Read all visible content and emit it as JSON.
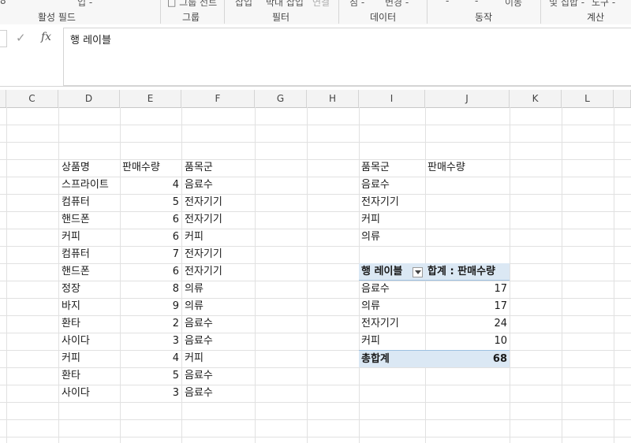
{
  "ribbon": {
    "top_fragments": [
      "8",
      "입 -",
      "□ 그룹 선트",
      "삽입",
      "박대 삽입",
      "연결",
      "침 -",
      "변경 -",
      "-",
      "-",
      "이동",
      "및 집합 -",
      "도구 -"
    ],
    "groups": [
      "활성 필드",
      "그룹",
      "필터",
      "데이터",
      "동작",
      "계산"
    ]
  },
  "formula_bar": {
    "content": "행 레이블"
  },
  "columns": [
    "C",
    "D",
    "E",
    "F",
    "G",
    "H",
    "I",
    "J",
    "K",
    "L"
  ],
  "source_table": {
    "headers": [
      "상품명",
      "판매수량",
      "품목군"
    ],
    "rows": [
      {
        "name": "스프라이트",
        "qty": "4",
        "cat": "음료수"
      },
      {
        "name": "컴퓨터",
        "qty": "5",
        "cat": "전자기기"
      },
      {
        "name": "핸드폰",
        "qty": "6",
        "cat": "전자기기"
      },
      {
        "name": "커피",
        "qty": "6",
        "cat": "커피"
      },
      {
        "name": "컴퓨터",
        "qty": "7",
        "cat": "전자기기"
      },
      {
        "name": "핸드폰",
        "qty": "6",
        "cat": "전자기기"
      },
      {
        "name": "정장",
        "qty": "8",
        "cat": "의류"
      },
      {
        "name": "바지",
        "qty": "9",
        "cat": "의류"
      },
      {
        "name": "환타",
        "qty": "2",
        "cat": "음료수"
      },
      {
        "name": "사이다",
        "qty": "3",
        "cat": "음료수"
      },
      {
        "name": "커피",
        "qty": "4",
        "cat": "커피"
      },
      {
        "name": "환타",
        "qty": "5",
        "cat": "음료수"
      },
      {
        "name": "사이다",
        "qty": "3",
        "cat": "음료수"
      }
    ]
  },
  "summary_table": {
    "headers": [
      "품목군",
      "판매수량"
    ],
    "rows": [
      "음료수",
      "전자기기",
      "커피",
      "의류"
    ]
  },
  "pivot": {
    "row_label": "행 레이블",
    "value_label": "합계 : 판매수량",
    "rows": [
      {
        "label": "음료수",
        "value": "17"
      },
      {
        "label": "의류",
        "value": "17"
      },
      {
        "label": "전자기기",
        "value": "24"
      },
      {
        "label": "커피",
        "value": "10"
      }
    ],
    "total_label": "총합계",
    "total_value": "68"
  },
  "icons": {
    "enter": "check-icon",
    "function": "fx-icon",
    "filter": "filter-dropdown-icon"
  }
}
